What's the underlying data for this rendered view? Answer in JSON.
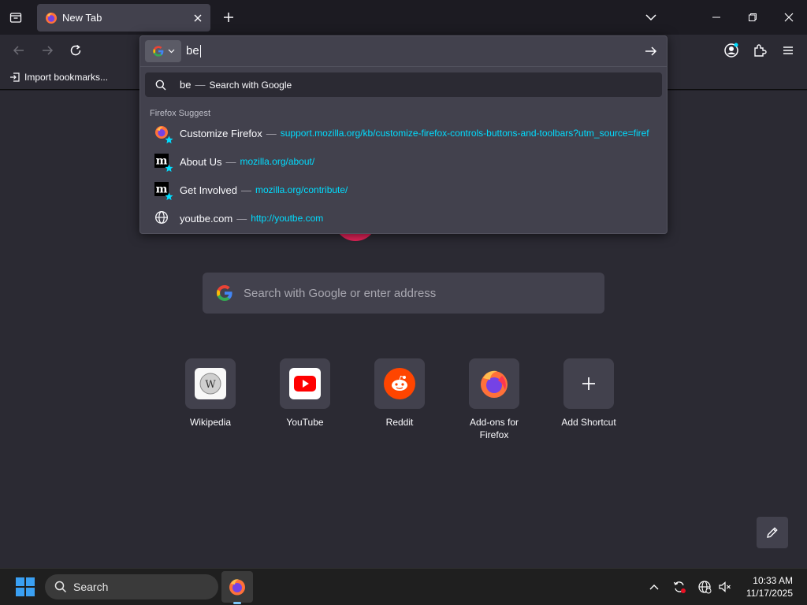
{
  "tab": {
    "title": "New Tab"
  },
  "bookmarks": {
    "import_label": "Import bookmarks..."
  },
  "urlbar": {
    "typed": "be",
    "heuristic": {
      "query": "be",
      "action": "Search with Google"
    },
    "group_label": "Firefox Suggest",
    "results": [
      {
        "title": "Customize Firefox",
        "url": "support.mozilla.org/kb/customize-firefox-controls-buttons-and-toolbars?utm_source=firef",
        "icon": "firefox-icon"
      },
      {
        "title": "About Us",
        "url": "mozilla.org/about/",
        "icon": "mozilla-icon"
      },
      {
        "title": "Get Involved",
        "url": "mozilla.org/contribute/",
        "icon": "mozilla-icon"
      },
      {
        "title": "youtbe.com",
        "url": "http://youtbe.com",
        "icon": "globe-icon"
      }
    ]
  },
  "newtab": {
    "search_placeholder": "Search with Google or enter address",
    "shortcuts": [
      {
        "label": "Wikipedia",
        "icon": "wikipedia-icon"
      },
      {
        "label": "YouTube",
        "icon": "youtube-icon"
      },
      {
        "label": "Reddit",
        "icon": "reddit-icon"
      },
      {
        "label": "Add-ons for Firefox",
        "icon": "firefox-icon"
      },
      {
        "label": "Add Shortcut",
        "icon": "plus-icon"
      }
    ]
  },
  "taskbar": {
    "search_label": "Search",
    "time": "10:33 AM",
    "date": "11/17/2025"
  },
  "colors": {
    "accent_url": "#00ddff",
    "panel": "#42414d",
    "toolbar": "#2b2a33",
    "frame": "#1c1b22"
  }
}
